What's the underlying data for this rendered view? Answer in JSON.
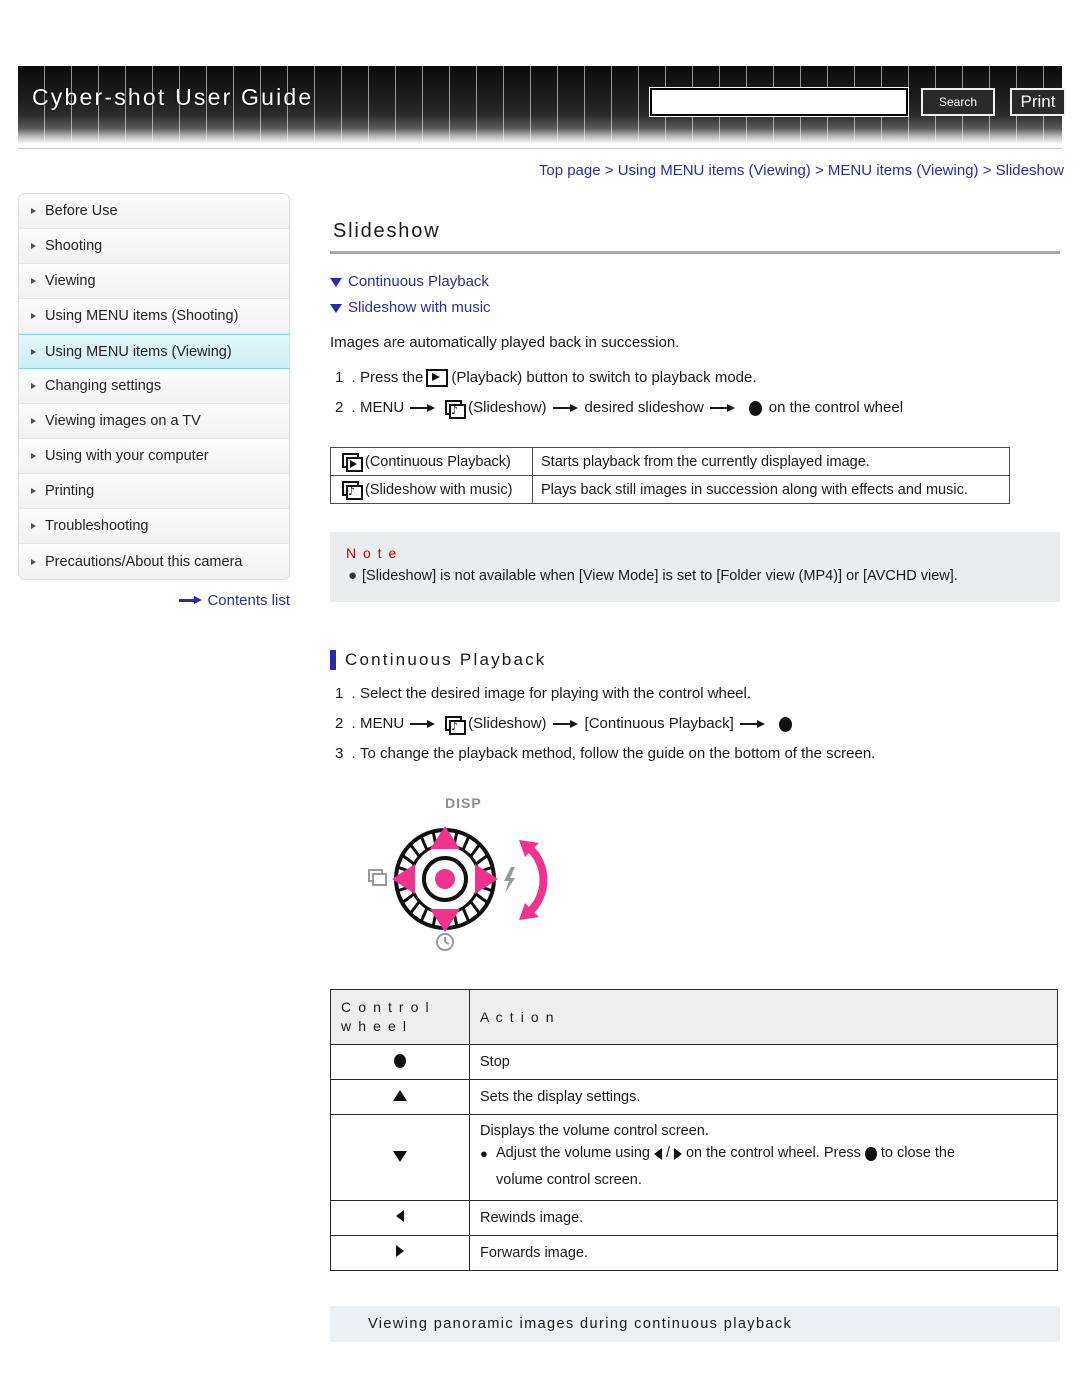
{
  "header": {
    "title": "Cyber-shot User Guide",
    "search_value": "",
    "search_placeholder": "",
    "search_button": "Search",
    "print_button": "Print"
  },
  "breadcrumb": {
    "items": [
      "Top page",
      "Using MENU items (Viewing)",
      "MENU items (Viewing)",
      "Slideshow"
    ],
    "separator": ">"
  },
  "sidebar": {
    "items": [
      {
        "label": "Before Use",
        "active": false
      },
      {
        "label": "Shooting",
        "active": false
      },
      {
        "label": "Viewing",
        "active": false
      },
      {
        "label": "Using MENU items (Shooting)",
        "active": false
      },
      {
        "label": "Using MENU items (Viewing)",
        "active": true
      },
      {
        "label": "Changing settings",
        "active": false
      },
      {
        "label": "Viewing images on a TV",
        "active": false
      },
      {
        "label": "Using with your computer",
        "active": false
      },
      {
        "label": "Printing",
        "active": false
      },
      {
        "label": "Troubleshooting",
        "active": false
      },
      {
        "label": "Precautions/About this camera",
        "active": false
      }
    ],
    "contents_link": "Contents list"
  },
  "main": {
    "page_title": "Slideshow",
    "anchors": [
      {
        "label": "Continuous Playback"
      },
      {
        "label": "Slideshow with music"
      }
    ],
    "intro": "Images are automatically played back in succession.",
    "steps": [
      {
        "num": "1 .",
        "parts": [
          {
            "t": "text",
            "v": "Press the"
          },
          {
            "t": "icon",
            "v": "playback-icon"
          },
          {
            "t": "text",
            "v": "(Playback) button to switch to playback mode."
          }
        ]
      },
      {
        "num": "2 .",
        "parts": [
          {
            "t": "text",
            "v": "MENU"
          },
          {
            "t": "arrow",
            "v": "arrow-right-icon"
          },
          {
            "t": "icon",
            "v": "slideshow-music-icon"
          },
          {
            "t": "text",
            "v": "(Slideshow)"
          },
          {
            "t": "arrow",
            "v": "arrow-right-icon"
          },
          {
            "t": "text",
            "v": "desired slideshow"
          },
          {
            "t": "arrow",
            "v": "arrow-right-icon"
          },
          {
            "t": "dot",
            "v": "center-button-icon"
          },
          {
            "t": "text",
            "v": "on the control wheel"
          }
        ]
      }
    ],
    "mode_table": {
      "rows": [
        {
          "icon": "continuous-playback-icon",
          "label": "(Continuous Playback)",
          "desc": "Starts playback from the currently displayed image."
        },
        {
          "icon": "slideshow-music-icon",
          "label": "(Slideshow with music)",
          "desc": "Plays back still images in succession along with effects and music."
        }
      ]
    },
    "note": {
      "title": "N o t e",
      "bullet": "●",
      "items": [
        "[Slideshow] is not available when [View Mode] is set to [Folder view (MP4)] or [AVCHD view]."
      ]
    },
    "section": {
      "heading": "Continuous Playback",
      "steps": [
        {
          "num": "1 .",
          "parts": [
            {
              "t": "text",
              "v": "Select the desired image for playing with the control wheel."
            }
          ]
        },
        {
          "num": "2 .",
          "parts": [
            {
              "t": "text",
              "v": "MENU"
            },
            {
              "t": "arrow",
              "v": "arrow-right-icon"
            },
            {
              "t": "icon",
              "v": "slideshow-music-icon"
            },
            {
              "t": "text",
              "v": "(Slideshow)"
            },
            {
              "t": "arrow",
              "v": "arrow-right-icon"
            },
            {
              "t": "text",
              "v": "[Continuous Playback]"
            },
            {
              "t": "arrow",
              "v": "arrow-right-icon"
            },
            {
              "t": "dot",
              "v": "center-button-icon"
            }
          ]
        },
        {
          "num": "3 .",
          "parts": [
            {
              "t": "text",
              "v": "To change the playback method, follow the guide on the bottom of the screen."
            }
          ]
        }
      ]
    },
    "wheel_figure": {
      "disp_label": "DISP",
      "left_icon": "burst-mode-icon",
      "right_icon": "flash-icon",
      "bottom_icon": "self-timer-icon",
      "rotate_icon": "rotate-arrow-icon",
      "accent_color": "#F0338C"
    },
    "action_table": {
      "headers": [
        "C o n t r o l\nw h e e l",
        "A c t i o n"
      ],
      "header_control": "C o n t r o l",
      "header_control2": "w h e e l",
      "header_action": "A c t i o n",
      "rows": [
        {
          "sym": "center-button-icon",
          "action": "Stop",
          "sub": null
        },
        {
          "sym": "up-triangle-icon",
          "action": "Sets the display settings.",
          "sub": null
        },
        {
          "sym": "down-triangle-icon",
          "action": "Displays the volume control screen.",
          "sub": {
            "pre": "Adjust the volume using",
            "mid": "/",
            "post": "on the control wheel. Press",
            "tail": "to close the",
            "line2": "volume control screen."
          }
        },
        {
          "sym": "left-triangle-icon",
          "action": "Rewinds image.",
          "sub": null
        },
        {
          "sym": "right-triangle-icon",
          "action": "Forwards image.",
          "sub": null
        }
      ]
    },
    "sub_bar": "Viewing panoramic images during continuous playback"
  }
}
